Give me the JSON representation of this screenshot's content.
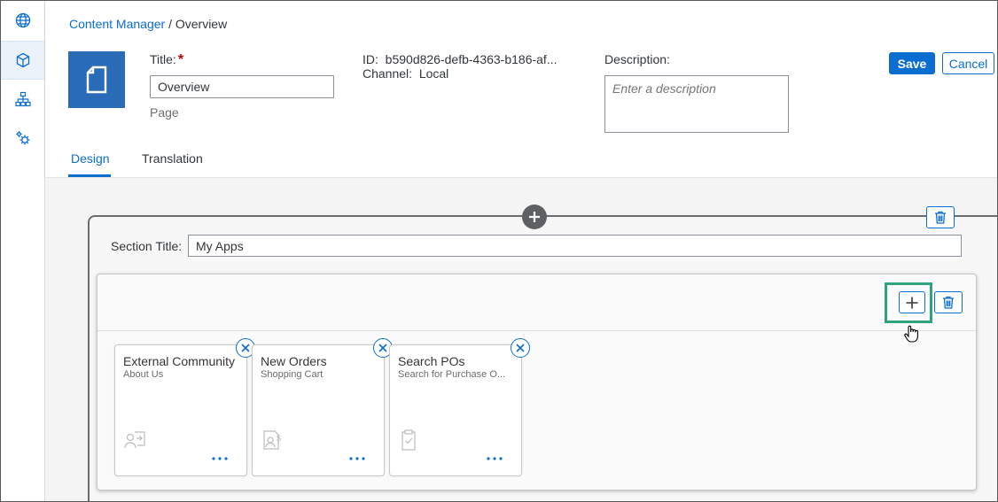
{
  "sidenav": {
    "items": [
      {
        "icon": "globe-icon"
      },
      {
        "icon": "cube-icon",
        "active": true
      },
      {
        "icon": "sitemap-icon"
      },
      {
        "icon": "gears-icon"
      }
    ]
  },
  "breadcrumb": {
    "parent": "Content Manager",
    "separator": "/",
    "current": "Overview"
  },
  "page": {
    "title_label": "Title:",
    "required_mark": "*",
    "title_value": "Overview",
    "type": "Page",
    "id_label": "ID:",
    "id_value": "b590d826-defb-4363-b186-af...",
    "channel_label": "Channel:",
    "channel_value": "Local",
    "description_label": "Description:",
    "description_placeholder": "Enter a description"
  },
  "actions": {
    "save": "Save",
    "cancel": "Cancel"
  },
  "tabs": {
    "design": "Design",
    "translation": "Translation",
    "active": "design"
  },
  "section": {
    "title_label": "Section Title:",
    "title_value": "My Apps"
  },
  "tiles": [
    {
      "title": "External Community",
      "subtitle": "About Us",
      "icon": "person-arrow-icon"
    },
    {
      "title": "New Orders",
      "subtitle": "Shopping Cart",
      "icon": "document-dollar-icon"
    },
    {
      "title": "Search POs",
      "subtitle": "Search for Purchase O...",
      "icon": "clipboard-check-icon"
    }
  ],
  "colors": {
    "accent": "#0a6ed1",
    "tile_blue": "#2a6cb8",
    "highlight_green": "#2fa37d",
    "required_red": "#bb0000"
  }
}
